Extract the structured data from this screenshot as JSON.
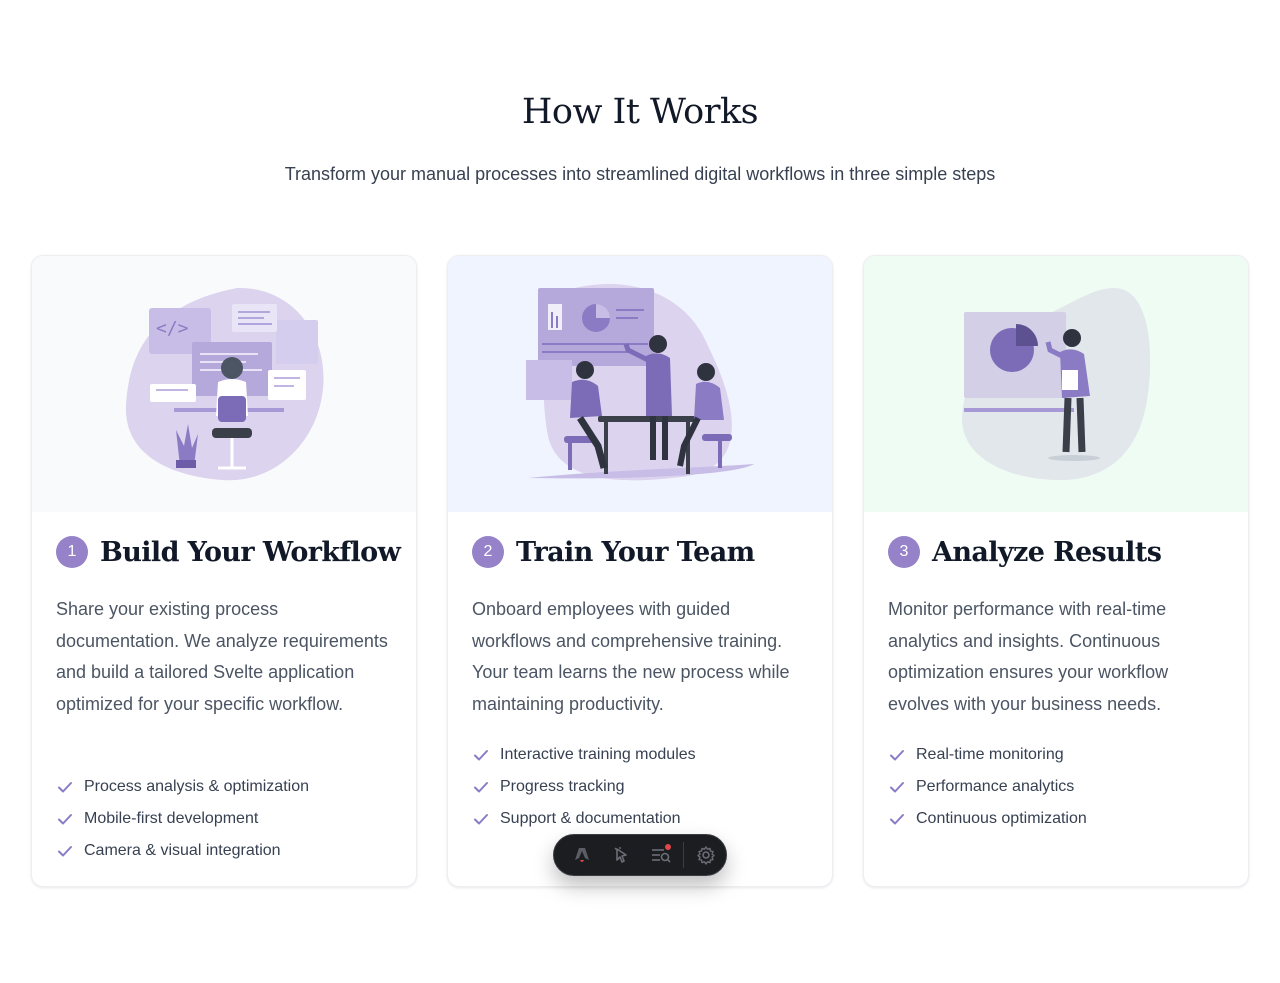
{
  "section": {
    "title": "How It Works",
    "subtitle": "Transform your manual processes into streamlined digital workflows in three simple steps"
  },
  "steps": [
    {
      "number": "1",
      "title": "Build Your Workflow",
      "description": "Share your existing process documentation. We analyze requirements and build a tailored Svelte application optimized for your specific workflow.",
      "features": [
        "Process analysis & optimization",
        "Mobile-first development",
        "Camera & visual integration"
      ],
      "illustration": "developer-coding-illustration"
    },
    {
      "number": "2",
      "title": "Train Your Team",
      "description": "Onboard employees with guided workflows and comprehensive training. Your team learns the new process while maintaining productivity.",
      "features": [
        "Interactive training modules",
        "Progress tracking",
        "Support & documentation"
      ],
      "illustration": "team-meeting-illustration"
    },
    {
      "number": "3",
      "title": "Analyze Results",
      "description": "Monitor performance with real-time analytics and insights. Continuous optimization ensures your workflow evolves with your business needs.",
      "features": [
        "Real-time monitoring",
        "Performance analytics",
        "Continuous optimization"
      ],
      "illustration": "presenter-chart-illustration"
    }
  ],
  "colors": {
    "accent": "#9582c9",
    "check": "#8b7bc4",
    "card1_bg": "#f9fafb",
    "card2_bg": "#eff4ff",
    "card3_bg": "#effcf3"
  },
  "toolbar": {
    "icons": [
      "astro-logo-icon",
      "inspect-cursor-icon",
      "audit-icon",
      "settings-gear-icon"
    ]
  }
}
